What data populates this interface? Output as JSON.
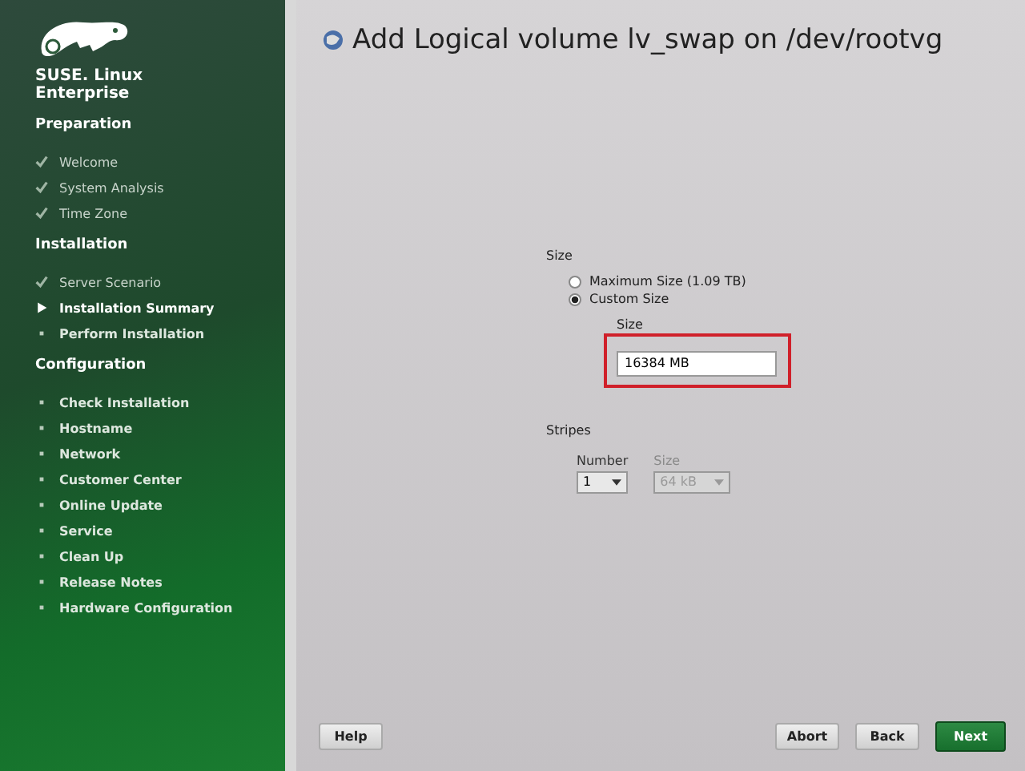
{
  "sidebar": {
    "brand": [
      "SUSE. Linux",
      "Enterprise"
    ],
    "groups": [
      {
        "title": "Preparation",
        "steps": [
          {
            "label": "Welcome",
            "kind": "done"
          },
          {
            "label": "System Analysis",
            "kind": "done"
          },
          {
            "label": "Time Zone",
            "kind": "done"
          }
        ]
      },
      {
        "title": "Installation",
        "steps": [
          {
            "label": "Server Scenario",
            "kind": "done"
          },
          {
            "label": "Installation Summary",
            "kind": "current"
          },
          {
            "label": "Perform Installation",
            "kind": "pending"
          }
        ]
      },
      {
        "title": "Configuration",
        "steps": [
          {
            "label": "Check Installation",
            "kind": "pending"
          },
          {
            "label": "Hostname",
            "kind": "pending"
          },
          {
            "label": "Network",
            "kind": "pending"
          },
          {
            "label": "Customer Center",
            "kind": "pending"
          },
          {
            "label": "Online Update",
            "kind": "pending"
          },
          {
            "label": "Service",
            "kind": "pending"
          },
          {
            "label": "Clean Up",
            "kind": "pending"
          },
          {
            "label": "Release Notes",
            "kind": "pending"
          },
          {
            "label": "Hardware Configuration",
            "kind": "pending"
          }
        ]
      }
    ]
  },
  "title": "Add Logical volume lv_swap on /dev/rootvg",
  "size": {
    "label": "Size",
    "options": [
      {
        "label": "Maximum Size (1.09 TB)",
        "selected": false
      },
      {
        "label": "Custom Size",
        "selected": true
      }
    ],
    "field_label": "Size",
    "value": "16384 MB",
    "highlighted": true
  },
  "stripes": {
    "label": "Stripes",
    "number": {
      "label": "Number",
      "value": "1",
      "disabled": false
    },
    "stripe_size": {
      "label": "Size",
      "value": "64 kB",
      "disabled": true
    }
  },
  "buttons": {
    "help": "Help",
    "abort": "Abort",
    "back": "Back",
    "next": "Next"
  }
}
